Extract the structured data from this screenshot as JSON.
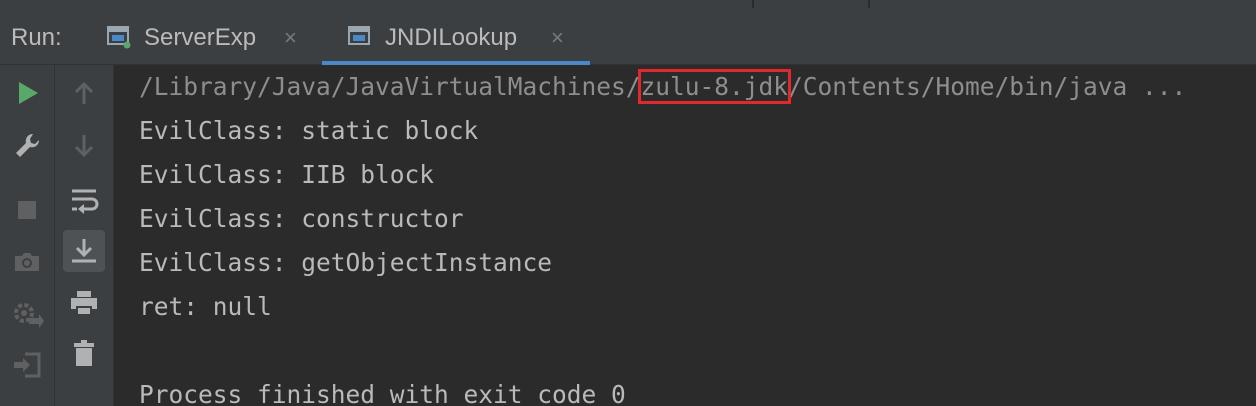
{
  "run_panel": {
    "label": "Run:",
    "tabs": [
      {
        "label": "ServerExp",
        "close": "×",
        "active": false
      },
      {
        "label": "JNDILookup",
        "close": "×",
        "active": true
      }
    ],
    "accent_color": "#4a88c7",
    "highlight_color": "#e0282e"
  },
  "left_toolbar": [
    {
      "name": "run-icon",
      "enabled": true
    },
    {
      "name": "wrench-icon",
      "enabled": true
    },
    {
      "name": "stop-icon",
      "enabled": false
    },
    {
      "name": "camera-icon",
      "enabled": false
    },
    {
      "name": "gear-arrow-icon",
      "enabled": false
    },
    {
      "name": "login-icon",
      "enabled": false
    }
  ],
  "console_toolbar": [
    {
      "name": "arrow-up-icon",
      "enabled": false
    },
    {
      "name": "arrow-down-icon",
      "enabled": false
    },
    {
      "name": "soft-wrap-icon",
      "enabled": true
    },
    {
      "name": "scroll-to-end-icon",
      "enabled": true,
      "toggled": true
    },
    {
      "name": "print-icon",
      "enabled": true
    },
    {
      "name": "trash-icon",
      "enabled": true
    }
  ],
  "console": {
    "command": {
      "prefix": "/Library/Java/JavaVirtualMachines/",
      "highlight": "zulu-8.jdk",
      "suffix": "/Contents/Home/bin/java ..."
    },
    "lines": [
      "EvilClass: static block",
      "EvilClass: IIB block",
      "EvilClass: constructor",
      "EvilClass: getObjectInstance",
      "ret: null",
      "",
      "Process finished with exit code 0"
    ]
  }
}
